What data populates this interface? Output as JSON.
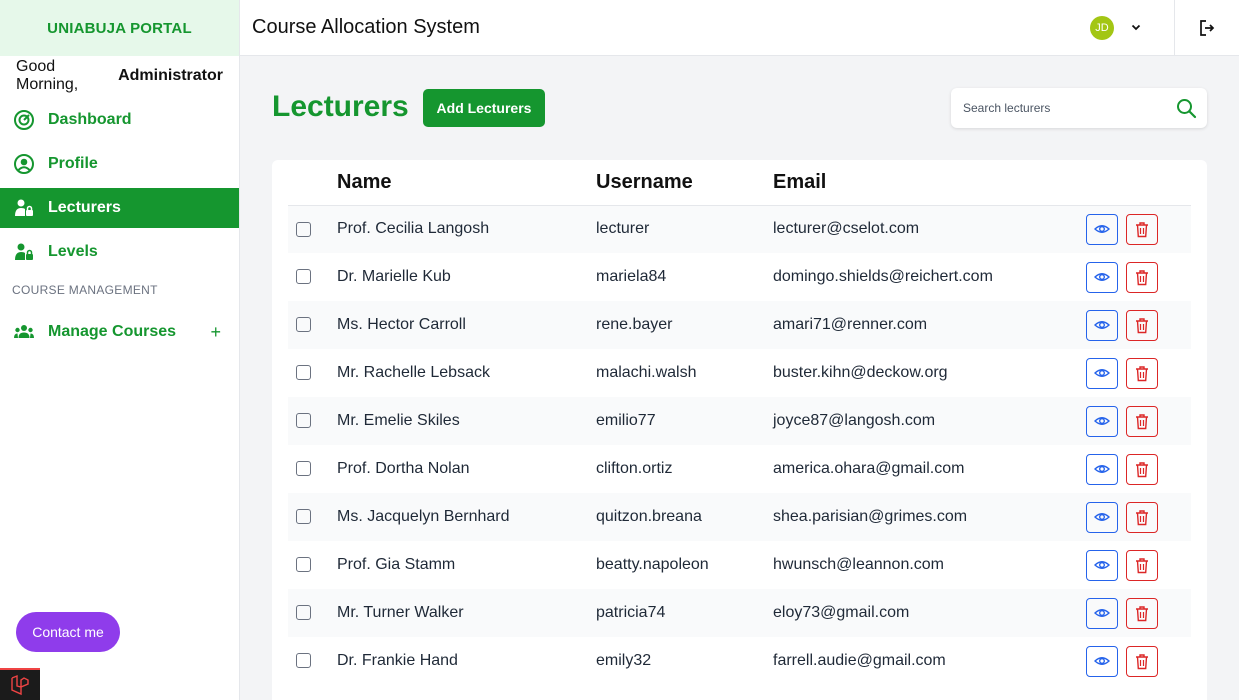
{
  "sidebar": {
    "brand": "UNIABUJA PORTAL",
    "greeting": "Good Morning,",
    "user_role": "Administrator",
    "items": [
      {
        "label": "Dashboard"
      },
      {
        "label": "Profile"
      },
      {
        "label": "Lecturers"
      },
      {
        "label": "Levels"
      }
    ],
    "section_label": "COURSE MANAGEMENT",
    "manage_courses": "Manage Courses",
    "contact_label": "Contact me"
  },
  "header": {
    "title": "Course Allocation System",
    "avatar_initials": "JD"
  },
  "main": {
    "page_title": "Lecturers",
    "add_button": "Add Lecturers",
    "search_placeholder": "Search lecturers",
    "columns": {
      "name": "Name",
      "username": "Username",
      "email": "Email"
    },
    "rows": [
      {
        "name": "Prof. Cecilia Langosh",
        "username": "lecturer",
        "email": "lecturer@cselot.com"
      },
      {
        "name": "Dr. Marielle Kub",
        "username": "mariela84",
        "email": "domingo.shields@reichert.com"
      },
      {
        "name": "Ms. Hector Carroll",
        "username": "rene.bayer",
        "email": "amari71@renner.com"
      },
      {
        "name": "Mr. Rachelle Lebsack",
        "username": "malachi.walsh",
        "email": "buster.kihn@deckow.org"
      },
      {
        "name": "Mr. Emelie Skiles",
        "username": "emilio77",
        "email": "joyce87@langosh.com"
      },
      {
        "name": "Prof. Dortha Nolan",
        "username": "clifton.ortiz",
        "email": "america.ohara@gmail.com"
      },
      {
        "name": "Ms. Jacquelyn Bernhard",
        "username": "quitzon.breana",
        "email": "shea.parisian@grimes.com"
      },
      {
        "name": "Prof. Gia Stamm",
        "username": "beatty.napoleon",
        "email": "hwunsch@leannon.com"
      },
      {
        "name": "Mr. Turner Walker",
        "username": "patricia74",
        "email": "eloy73@gmail.com"
      },
      {
        "name": "Dr. Frankie Hand",
        "username": "emily32",
        "email": "farrell.audie@gmail.com"
      }
    ]
  },
  "colors": {
    "brand_green": "#15962f",
    "contact_purple": "#8f3ceb",
    "view_blue": "#2563eb",
    "delete_red": "#dc2626"
  },
  "icons": {
    "dashboard": "dashboard-icon",
    "profile": "user-circle-icon",
    "lecturers": "lock-user-icon",
    "levels": "lock-user-icon",
    "manage_courses": "users-icon",
    "search": "search-icon",
    "view": "eye-icon",
    "delete": "trash-icon",
    "logout": "logout-icon",
    "chevron": "chevron-down-icon"
  }
}
